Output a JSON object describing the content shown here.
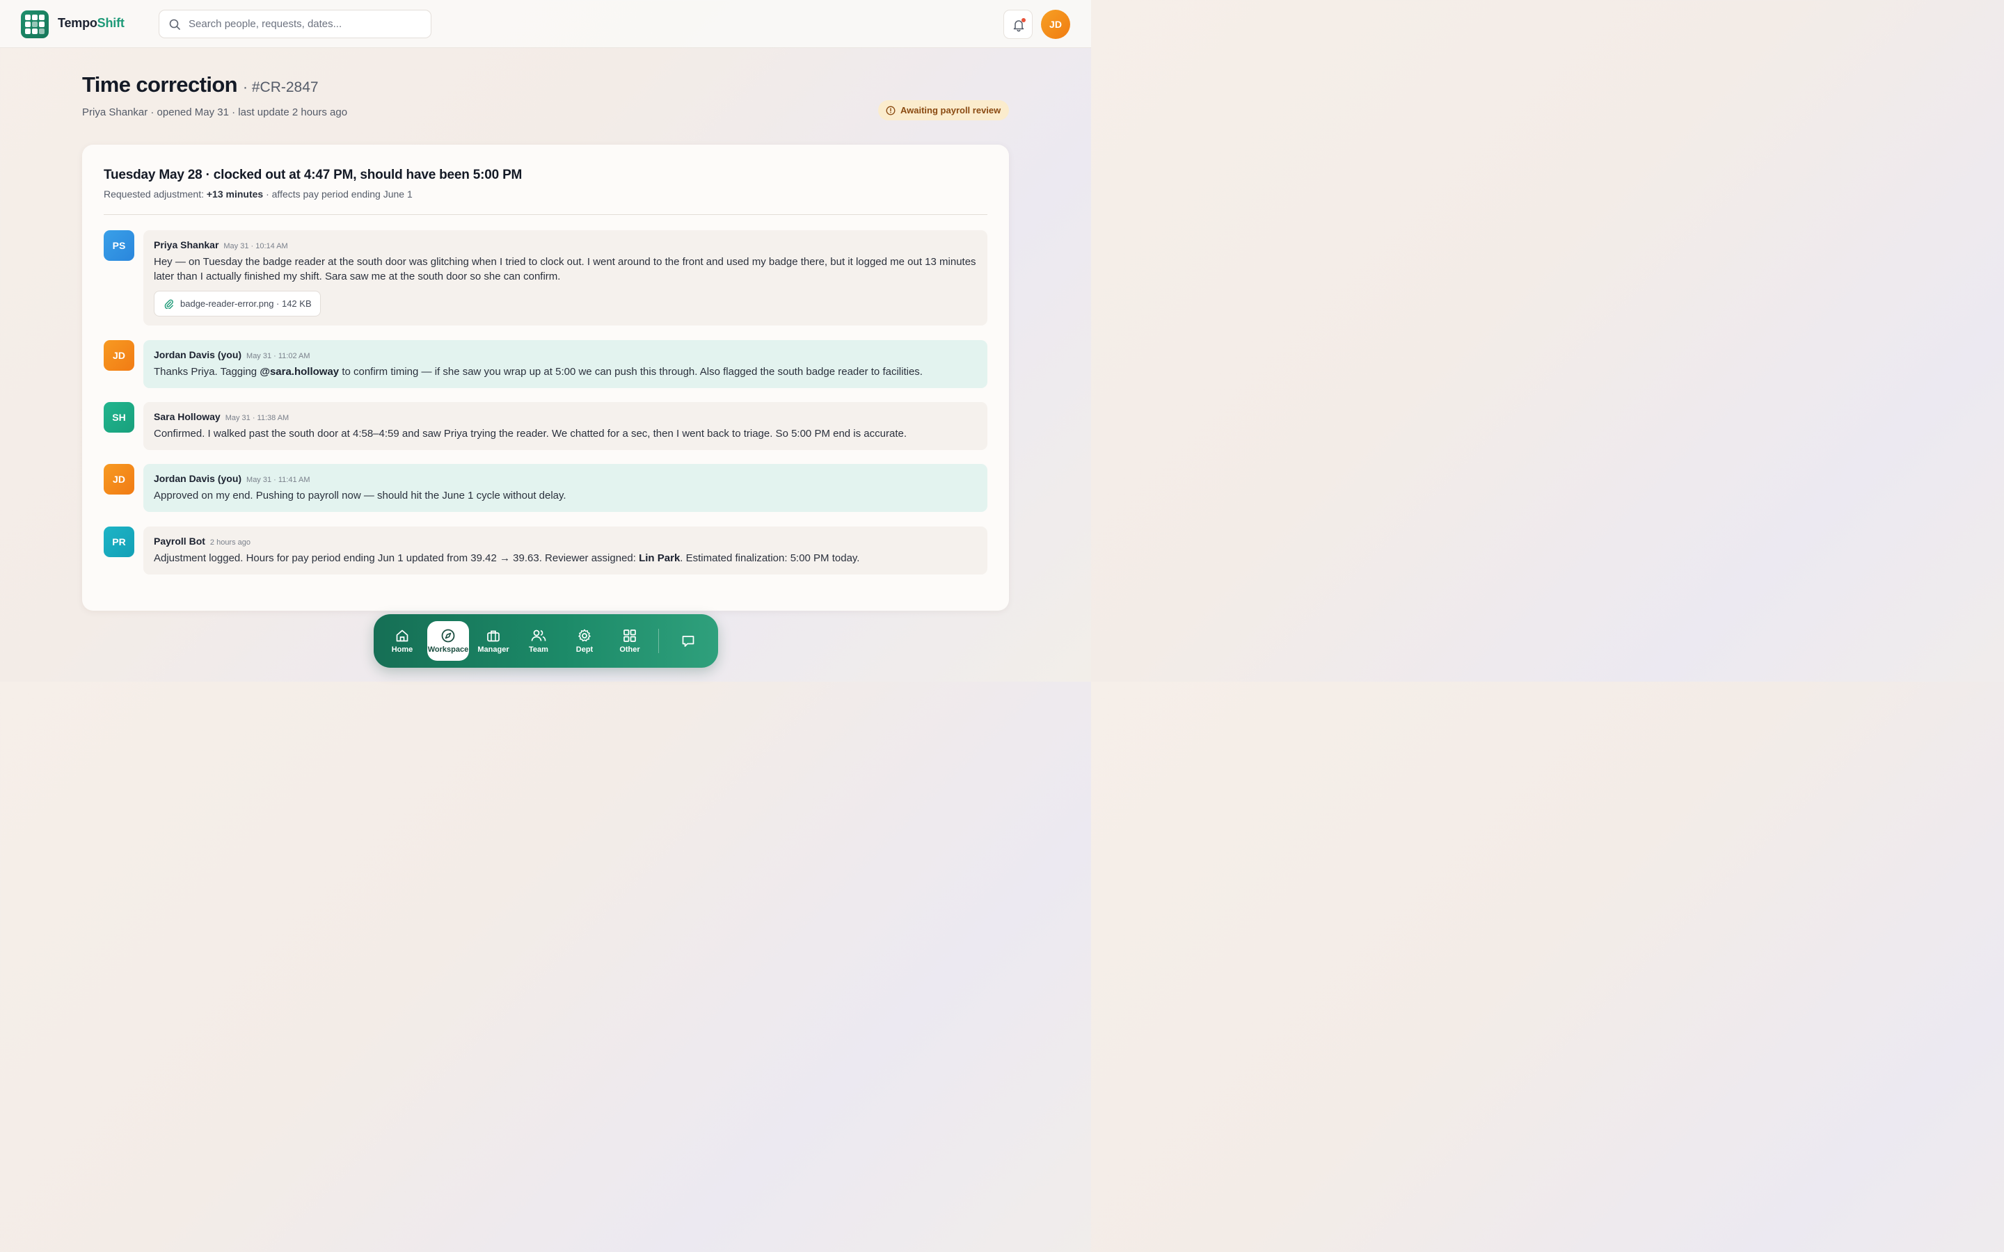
{
  "app": {
    "brand_part1": "Tempo",
    "brand_part2": "Shift",
    "user_initials": "JD"
  },
  "search": {
    "placeholder": "Search people, requests, dates..."
  },
  "page": {
    "title": "Time correction",
    "request_id": "· #CR-2847",
    "meta": "Priya Shankar · opened May 31 · last update 2 hours ago",
    "status": "Awaiting payroll review"
  },
  "card": {
    "title": "Tuesday May 28 · clocked out at 4:47 PM, should have been 5:00 PM",
    "sub_prefix": "Requested adjustment: ",
    "sub_adjustment": "+13 minutes",
    "sub_suffix": " · affects pay period ending June 1"
  },
  "messages": [
    {
      "initials": "PS",
      "author": "Priya Shankar",
      "time": "May 31 · 10:14 AM",
      "text": "Hey — on Tuesday the badge reader at the south door was glitching when I tried to clock out. I went around to the front and used my badge there, but it logged me out 13 minutes later than I actually finished my shift. Sara saw me at the south door so she can confirm.",
      "attachment": "badge-reader-error.png · 142 KB"
    },
    {
      "initials": "JD",
      "author": "Jordan Davis (you)",
      "time": "May 31 · 11:02 AM",
      "text_before": "Thanks Priya. Tagging ",
      "mention": "@sara.holloway",
      "text_after": " to confirm timing — if she saw you wrap up at 5:00 we can push this through. Also flagged the south badge reader to facilities."
    },
    {
      "initials": "SH",
      "author": "Sara Holloway",
      "time": "May 31 · 11:38 AM",
      "text": "Confirmed. I walked past the south door at 4:58–4:59 and saw Priya trying the reader. We chatted for a sec, then I went back to triage. So 5:00 PM end is accurate."
    },
    {
      "initials": "JD",
      "author": "Jordan Davis (you)",
      "time": "May 31 · 11:41 AM",
      "text": "Approved on my end. Pushing to payroll now — should hit the June 1 cycle without delay."
    },
    {
      "initials": "PR",
      "author": "Payroll Bot",
      "time": "2 hours ago",
      "text_before": "Adjustment logged. Hours for pay period ending Jun 1 updated from 39.42 → 39.63. Reviewer assigned: ",
      "reviewer": "Lin Park",
      "text_after": ". Estimated finalization: 5:00 PM today."
    }
  ],
  "dock": {
    "items": [
      {
        "label": "Home",
        "icon": "home-icon"
      },
      {
        "label": "Workspace",
        "icon": "compass-icon"
      },
      {
        "label": "Manager",
        "icon": "briefcase-icon"
      },
      {
        "label": "Team",
        "icon": "users-icon"
      },
      {
        "label": "Dept",
        "icon": "gear-icon"
      },
      {
        "label": "Other",
        "icon": "grid-icon"
      }
    ],
    "active": "Workspace",
    "chat_icon": "chat-icon"
  },
  "colors": {
    "brand_green": "#1e9a78",
    "status_bg": "#fbeccd",
    "status_text": "#8a4a12",
    "mine_bubble": "#e3f3ef"
  }
}
